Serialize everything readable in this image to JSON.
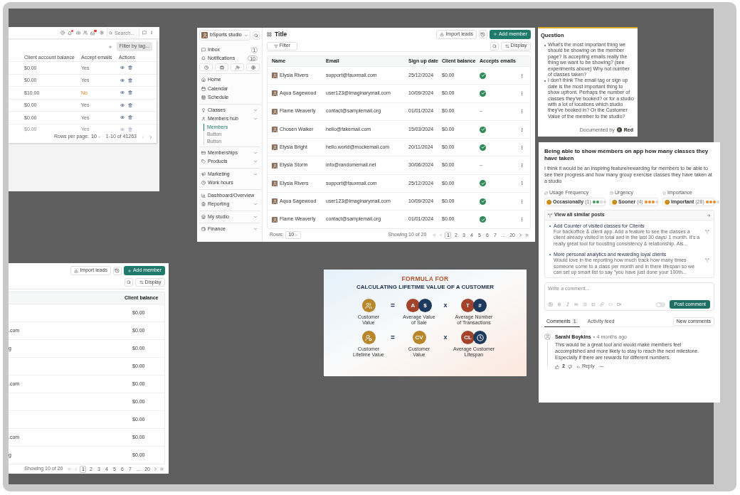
{
  "canvas": {
    "admin_table": {
      "search": {
        "placeholder": "Search..."
      },
      "filter_button": "Filter by tag...",
      "columns": [
        "Client account balance",
        "Accept emails",
        "Actions"
      ],
      "rows": [
        {
          "balance": "$0.00",
          "accept": "Yes",
          "accepts": true,
          "faded": false
        },
        {
          "balance": "$0.00",
          "accept": "Yes",
          "accepts": true,
          "faded": false
        },
        {
          "balance": "$10.00",
          "accept": "No",
          "accepts": false,
          "faded": false
        },
        {
          "balance": "$0.00",
          "accept": "Yes",
          "accepts": true,
          "faded": false
        },
        {
          "balance": "$0.00",
          "accept": "Yes",
          "accepts": true,
          "faded": false
        },
        {
          "balance": "$0.00",
          "accept": "Yes",
          "accepts": true,
          "faded": true
        }
      ],
      "pagination": {
        "rows_per_page_label": "Rows per page:",
        "rows_per_page": "10",
        "range": "1-10 of 41263"
      }
    },
    "members_page": {
      "sidebar": {
        "studio": "bSports studio",
        "top_items": [
          {
            "label": "Inbox",
            "count": "1"
          },
          {
            "label": "Notifications",
            "count": "10"
          }
        ],
        "groups": [
          [
            {
              "label": "Home",
              "expandable": false
            },
            {
              "label": "Calendar",
              "expandable": false
            },
            {
              "label": "Schedule",
              "expandable": false
            }
          ],
          [
            {
              "label": "Classes",
              "expandable": true
            },
            {
              "label": "Members hub",
              "expandable": true,
              "children": [
                {
                  "label": "Members",
                  "selected": true
                },
                {
                  "label": "Button",
                  "selected": false
                },
                {
                  "label": "Button",
                  "selected": false
                }
              ]
            }
          ],
          [
            {
              "label": "Memberships",
              "expandable": true
            },
            {
              "label": "Products",
              "expandable": true
            }
          ],
          [
            {
              "label": "Marketing",
              "expandable": true
            },
            {
              "label": "Work hours",
              "expandable": false
            }
          ],
          [
            {
              "label": "Dashboard/Overview",
              "expandable": false
            },
            {
              "label": "Reporting",
              "expandable": true
            }
          ],
          [
            {
              "label": "My studio",
              "expandable": true
            }
          ],
          [
            {
              "label": "Finance",
              "expandable": true
            }
          ]
        ]
      },
      "header": {
        "title": "Title",
        "import_button": "Import leads",
        "add_button": "Add member"
      },
      "toolbar": {
        "filter_button": "Filter",
        "display_button": "Display"
      },
      "table": {
        "columns": [
          "Name",
          "Email",
          "Sign up date",
          "Client balance",
          "Accepts emails"
        ],
        "rows": [
          {
            "name": "Elysia Rivers",
            "email": "support@fauxmail.com",
            "signup": "25/12/2024",
            "balance": "$0.00",
            "accepts": true
          },
          {
            "name": "Aqua Sagewood",
            "email": "user123@imaginarymail.com",
            "signup": "10/09/2024",
            "balance": "$0.00",
            "accepts": true
          },
          {
            "name": "Flame Weaverly",
            "email": "contact@samplemail.org",
            "signup": "01/01/2024",
            "balance": "$0.00",
            "accepts": false,
            "accepts_text": "--"
          },
          {
            "name": "Chosen Walker",
            "email": "hello@fakemail.com",
            "signup": "15/03/2024",
            "balance": "$0.00",
            "accepts": true
          },
          {
            "name": "Elysia Bright",
            "email": "hello.world@mockemail.com",
            "signup": "20/11/2024",
            "balance": "$0.00",
            "accepts": true
          },
          {
            "name": "Elysia Storm",
            "email": "info@randomemail.net",
            "signup": "30/06/2024",
            "balance": "$0.00",
            "accepts": false,
            "accepts_text": "--"
          },
          {
            "name": "Elysia Rivers",
            "email": "support@fauxmail.com",
            "signup": "25/12/2024",
            "balance": "$0.00",
            "accepts": true
          },
          {
            "name": "Aqua Sagewood",
            "email": "user123@imaginarymail.com",
            "signup": "10/09/2024",
            "balance": "$0.00",
            "accepts": true
          },
          {
            "name": "Flame Weaverly",
            "email": "contact@samplemail.org",
            "signup": "01/01/2024",
            "balance": "$0.00",
            "accepts": true
          }
        ]
      },
      "pagination": {
        "rows_label": "Rows:",
        "rows_value": "10",
        "showing": "Showing 10 of 20",
        "pages": [
          {
            "label": "1",
            "selected": true
          },
          {
            "label": "2",
            "selected": false
          },
          {
            "label": "3",
            "selected": false
          },
          {
            "label": "4",
            "selected": false
          },
          {
            "label": "5",
            "selected": false
          },
          {
            "label": "6",
            "selected": false
          },
          {
            "label": "7",
            "selected": false
          },
          {
            "label": "...",
            "selected": false
          },
          {
            "label": "20",
            "selected": false
          }
        ]
      }
    },
    "question_note": {
      "title": "Question",
      "bullets": [
        "What's the most important thing we should be showing on the member page? Is accepting emails really the thing we want to be showing? (see experiments above) Why not number of classes taken?",
        "I don't think The email tag or sign up date is the most important thing to show upfront. Perhaps the number of classes they've booked? or for a studio with a lot of locations which studio they've booked in? Or the Customer Value of the member to the studio?"
      ],
      "footer_label": "Documented by",
      "author": "Red"
    },
    "feature_request": {
      "title": "Being able to show members on app how many classes they have taken",
      "description": "I think it would be an inspiring feature/rewarding for members to be able to see their progress and how many group exercise classes they have taken at a studio",
      "ratings": [
        {
          "label": "Usage Frequency",
          "value": "Occasionally",
          "count": "(1)",
          "stars": 2,
          "color": "#3a9d5d"
        },
        {
          "label": "Urgency",
          "value": "Sooner",
          "count": "(4)",
          "stars": 3,
          "color": "#e8892b"
        },
        {
          "label": "Importance",
          "value": "Important",
          "count": "(28)",
          "stars": 3,
          "color": "#e8892b"
        }
      ],
      "similar_posts": {
        "title": "View all similar posts",
        "posts": [
          {
            "title": "Add Counter of visited classes for Clients",
            "excerpt": "For backoffice & client app. Add a feature to see the classes a client already visited in total and in the last 30 days/ 1 month. It's a really great tool for boosting consistency & relationship. Als..."
          },
          {
            "title": "More personal analytics and rewarding loyal clients",
            "excerpt": "Would love in the reporting how much track how many times someone come to a class per month and in there lifespan so we can set up smart list to say \"you have just done your 100th..."
          }
        ]
      },
      "composer": {
        "placeholder": "Write a comment...",
        "toggle_on": false,
        "submit_button": "Post comment"
      },
      "tabs": [
        {
          "label": "Comments",
          "count": "1",
          "selected": true
        },
        {
          "label": "Activity feed",
          "selected": false
        }
      ],
      "new_comments_button": "New comments",
      "comment": {
        "author": "Sarahi Boykins",
        "time": "4 months ago",
        "text": "This would be a great tool and would make members feel accomplished and more likely to stay to reach the next milestone. Especially if there are rewards for different numbers.",
        "likes": "2",
        "reply": "Reply"
      }
    },
    "members_table_crop": {
      "import_button": "Import leads",
      "add_button": "Add member",
      "display_button": "Display",
      "column": "Client balance",
      "rows": [
        {
          "balance": "$0.00"
        },
        {
          "email_fragment": ".com",
          "balance": "$0.00"
        },
        {
          "email_fragment": "g",
          "balance": "$0.00"
        },
        {
          "balance": "$0.00"
        },
        {
          "email_fragment": ".com",
          "balance": "$0.00"
        },
        {
          "balance": "$0.00"
        },
        {
          "balance": "$0.00"
        },
        {
          "email_fragment": ".com",
          "balance": "$0.00"
        },
        {
          "email_fragment": "g",
          "balance": "$0.00"
        }
      ],
      "pagination": {
        "showing": "Showing 10 of 20",
        "pages": [
          {
            "label": "1",
            "selected": true
          },
          {
            "label": "2",
            "selected": false
          },
          {
            "label": "3",
            "selected": false
          },
          {
            "label": "4",
            "selected": false
          },
          {
            "label": "5",
            "selected": false
          },
          {
            "label": "6",
            "selected": false
          },
          {
            "label": "7",
            "selected": false
          },
          {
            "label": "...",
            "selected": false
          },
          {
            "label": "20",
            "selected": false
          }
        ]
      }
    },
    "ltv_infographic": {
      "kicker": "FORMULA FOR",
      "title": "CALCULATING LIFETIME VALUE OF A CUSTOMER",
      "equations": [
        {
          "result": "Customer Value",
          "equals": "=",
          "times": "x",
          "terms": [
            {
              "label": "Average Value of Sale",
              "badges": [
                {
                  "kind": "letter",
                  "text": "A",
                  "color": "#a4432b"
                },
                {
                  "kind": "letter",
                  "text": "$",
                  "color": "#1d3a5c"
                }
              ]
            },
            {
              "label": "Average Number of Transactions",
              "badges": [
                {
                  "kind": "letter",
                  "text": "T",
                  "color": "#a4432b"
                },
                {
                  "kind": "letter",
                  "text": "#",
                  "color": "#1d3a5c"
                }
              ]
            }
          ]
        },
        {
          "result": "Customer Lifetime Value",
          "equals": "=",
          "times": "x",
          "terms": [
            {
              "label": "Customer Value",
              "badges": [
                {
                  "kind": "letter",
                  "text": "CV",
                  "color": "#b8862b"
                }
              ]
            },
            {
              "label": "Average Customer Lifespan",
              "badges": [
                {
                  "kind": "letter",
                  "text": "CL",
                  "color": "#a4432b"
                },
                {
                  "kind": "clock",
                  "color": "#1d3a5c"
                }
              ]
            }
          ]
        }
      ]
    }
  }
}
